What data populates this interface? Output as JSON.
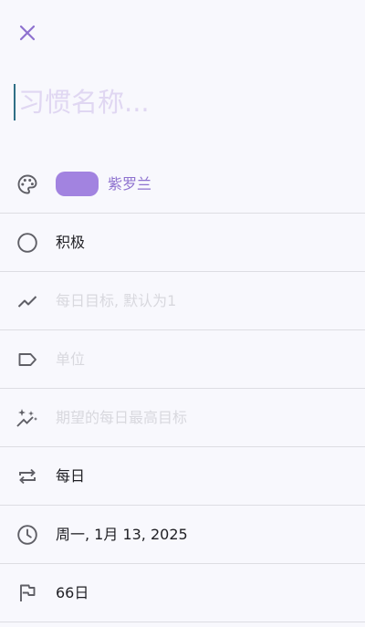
{
  "toolbar": {
    "close_icon": "close-icon"
  },
  "habit_name": {
    "placeholder": "习惯名称...",
    "value": ""
  },
  "fields": {
    "color": {
      "icon": "palette-icon",
      "label": "紫罗兰",
      "swatch_color": "#a283e0"
    },
    "type": {
      "icon": "circle-icon",
      "label": "积极"
    },
    "daily_goal": {
      "icon": "trending-icon",
      "placeholder": "每日目标, 默认为1"
    },
    "unit": {
      "icon": "label-icon",
      "placeholder": "单位"
    },
    "daily_max": {
      "icon": "sparkle-icon",
      "placeholder": "期望的每日最高目标"
    },
    "frequency": {
      "icon": "repeat-icon",
      "label": "每日"
    },
    "start_date": {
      "icon": "clock-icon",
      "label": "周一, 1月 13, 2025"
    },
    "goal_days": {
      "icon": "flag-icon",
      "label": "66日"
    }
  },
  "colors": {
    "accent": "#8e72cf",
    "icon": "#5f5f66",
    "placeholder": "#d8d8de",
    "background": "#f8f8fd"
  }
}
